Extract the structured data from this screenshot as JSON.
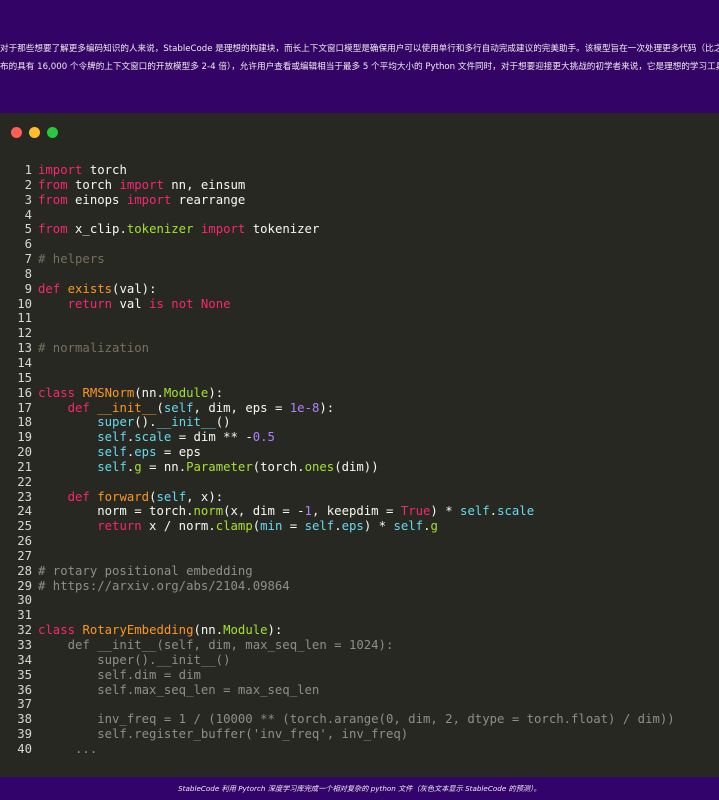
{
  "intro": {
    "line1": "对于那些想要了解更多编码知识的人来说，StableCode 是理想的构建块，而长上下文窗口模型是确保用户可以使用单行和多行自动完成建议的完美助手。该模型旨在一次处理更多代码（比之前发",
    "line2": "布的具有 16,000 个令牌的上下文窗口的开放模型多 2-4 倍），允许用户查看或编辑相当于最多 5 个平均大小的 Python 文件同时，对于想要迎接更大挑战的初学者来说，它是理想的学习工具。"
  },
  "window_dots": {
    "close": "#ff5f56",
    "minimize": "#ffbd2e",
    "maximize": "#27c93f"
  },
  "colors": {
    "keyword": "#f92672",
    "function": "#fd971f",
    "builtin": "#a6e22e",
    "identifier": "#66d9ef",
    "number": "#ae81ff",
    "comment": "#75715e",
    "prediction": "#8f8f88"
  },
  "code_lines": [
    [
      [
        "k",
        "import"
      ],
      [
        "p",
        " torch"
      ]
    ],
    [
      [
        "k",
        "from"
      ],
      [
        "p",
        " torch "
      ],
      [
        "k",
        "import"
      ],
      [
        "p",
        " nn, einsum"
      ]
    ],
    [
      [
        "k",
        "from"
      ],
      [
        "p",
        " einops "
      ],
      [
        "k",
        "import"
      ],
      [
        "p",
        " rearrange"
      ]
    ],
    [],
    [
      [
        "k",
        "from"
      ],
      [
        "p",
        " x_clip."
      ],
      [
        "g",
        "tokenizer"
      ],
      [
        "p",
        " "
      ],
      [
        "k",
        "import"
      ],
      [
        "p",
        " tokenizer"
      ]
    ],
    [],
    [
      [
        "m",
        "# helpers"
      ]
    ],
    [],
    [
      [
        "k",
        "def"
      ],
      [
        "p",
        " "
      ],
      [
        "f",
        "exists"
      ],
      [
        "p",
        "(val):"
      ]
    ],
    [
      [
        "p",
        "    "
      ],
      [
        "k",
        "return"
      ],
      [
        "p",
        " val "
      ],
      [
        "k",
        "is not None"
      ]
    ],
    [],
    [],
    [
      [
        "m",
        "# normalization"
      ]
    ],
    [],
    [],
    [
      [
        "k",
        "class"
      ],
      [
        "p",
        " "
      ],
      [
        "f",
        "RMSNorm"
      ],
      [
        "p",
        "(nn."
      ],
      [
        "g",
        "Module"
      ],
      [
        "p",
        "):"
      ]
    ],
    [
      [
        "p",
        "    "
      ],
      [
        "k",
        "def"
      ],
      [
        "p",
        " "
      ],
      [
        "f",
        "__init__"
      ],
      [
        "p",
        "("
      ],
      [
        "c",
        "self"
      ],
      [
        "p",
        ", dim, eps = "
      ],
      [
        "n",
        "1e-8"
      ],
      [
        "p",
        "):"
      ]
    ],
    [
      [
        "p",
        "        "
      ],
      [
        "c",
        "super"
      ],
      [
        "p",
        "()."
      ],
      [
        "c",
        "__init__"
      ],
      [
        "p",
        "()"
      ]
    ],
    [
      [
        "p",
        "        "
      ],
      [
        "c",
        "self"
      ],
      [
        "p",
        "."
      ],
      [
        "c",
        "scale"
      ],
      [
        "p",
        " = dim ** -"
      ],
      [
        "n",
        "0.5"
      ]
    ],
    [
      [
        "p",
        "        "
      ],
      [
        "c",
        "self"
      ],
      [
        "p",
        "."
      ],
      [
        "c",
        "eps"
      ],
      [
        "p",
        " = eps"
      ]
    ],
    [
      [
        "p",
        "        "
      ],
      [
        "c",
        "self"
      ],
      [
        "p",
        "."
      ],
      [
        "g",
        "g"
      ],
      [
        "p",
        " = nn."
      ],
      [
        "g",
        "Parameter"
      ],
      [
        "p",
        "(torch."
      ],
      [
        "g",
        "ones"
      ],
      [
        "p",
        "(dim))"
      ]
    ],
    [],
    [
      [
        "p",
        "    "
      ],
      [
        "k",
        "def"
      ],
      [
        "p",
        " "
      ],
      [
        "f",
        "forward"
      ],
      [
        "p",
        "("
      ],
      [
        "c",
        "self"
      ],
      [
        "p",
        ", x):"
      ]
    ],
    [
      [
        "p",
        "        norm = torch."
      ],
      [
        "g",
        "norm"
      ],
      [
        "p",
        "(x, dim = -"
      ],
      [
        "n",
        "1"
      ],
      [
        "p",
        ", keepdim = "
      ],
      [
        "k",
        "True"
      ],
      [
        "p",
        ") * "
      ],
      [
        "c",
        "self"
      ],
      [
        "p",
        "."
      ],
      [
        "c",
        "scale"
      ]
    ],
    [
      [
        "p",
        "        "
      ],
      [
        "k",
        "return"
      ],
      [
        "p",
        " x / norm."
      ],
      [
        "g",
        "clamp"
      ],
      [
        "p",
        "("
      ],
      [
        "c",
        "min"
      ],
      [
        "p",
        " = "
      ],
      [
        "c",
        "self"
      ],
      [
        "p",
        "."
      ],
      [
        "c",
        "eps"
      ],
      [
        "p",
        ") * "
      ],
      [
        "c",
        "self"
      ],
      [
        "p",
        "."
      ],
      [
        "g",
        "g"
      ]
    ],
    [],
    [],
    [
      [
        "x",
        "# rotary positional embedding"
      ]
    ],
    [
      [
        "x",
        "# https://arxiv.org/abs/2104.09864"
      ]
    ],
    [],
    [],
    [
      [
        "k",
        "class"
      ],
      [
        "p",
        " "
      ],
      [
        "f",
        "RotaryEmbedding"
      ],
      [
        "p",
        "(nn."
      ],
      [
        "g",
        "Module"
      ],
      [
        "p",
        "):"
      ]
    ],
    [
      [
        "x",
        "    def __init__(self, dim, max_seq_len = 1024):"
      ]
    ],
    [
      [
        "x",
        "        super().__init__()"
      ]
    ],
    [
      [
        "x",
        "        self.dim = dim"
      ]
    ],
    [
      [
        "x",
        "        self.max_seq_len = max_seq_len"
      ]
    ],
    [],
    [
      [
        "x",
        "        inv_freq = 1 / (10000 ** (torch.arange(0, dim, 2, dtype = torch.float) / dim))"
      ]
    ],
    [
      [
        "x",
        "        self.register_buffer('inv_freq', inv_freq)"
      ]
    ],
    [
      [
        "x",
        "     ..."
      ]
    ]
  ],
  "caption": "StableCode 利用 Pytorch 深度学习库完成一个相对复杂的 python 文件（灰色文本显示 StableCode 的预测）。"
}
